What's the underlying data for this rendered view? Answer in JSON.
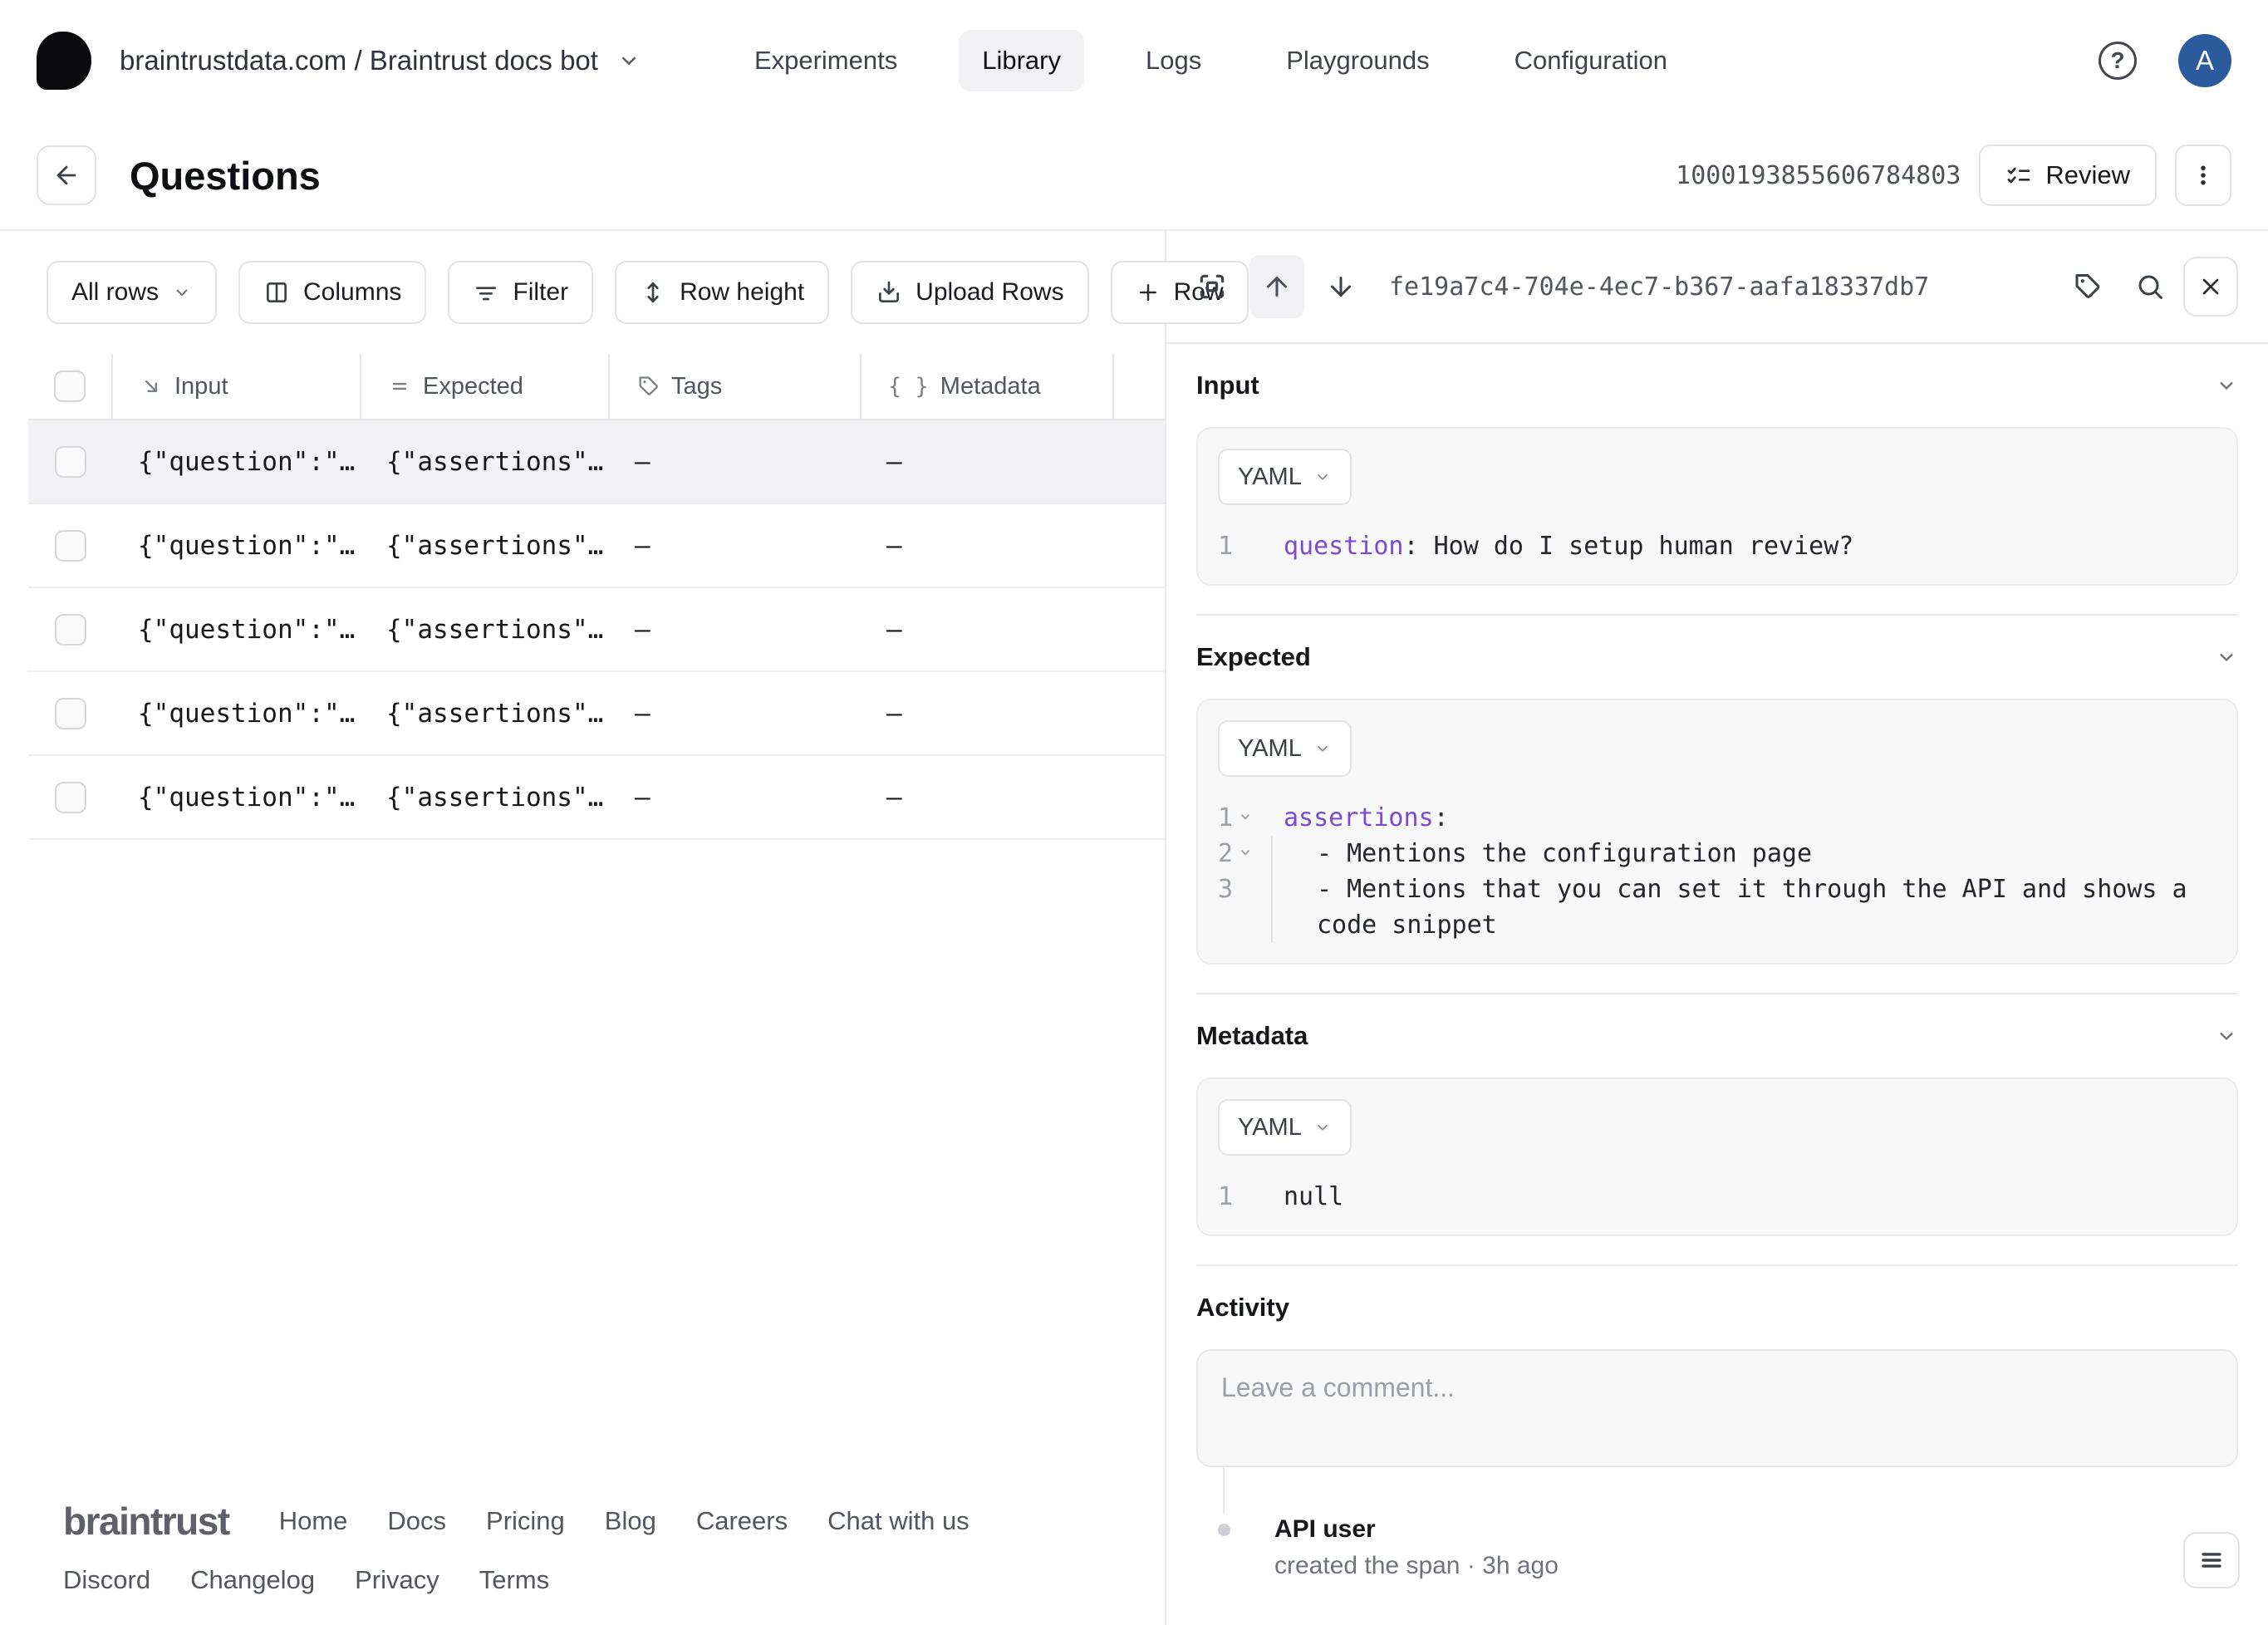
{
  "colors": {
    "accent_purple": "#7a4bd2",
    "avatar_blue": "#2b5b9d",
    "active_tab_bg": "#f2f2f4",
    "selected_row_bg": "#f2f2f4"
  },
  "topnav": {
    "breadcrumb": "braintrustdata.com / Braintrust docs bot",
    "tabs": [
      {
        "label": "Experiments"
      },
      {
        "label": "Library"
      },
      {
        "label": "Logs"
      },
      {
        "label": "Playgrounds"
      },
      {
        "label": "Configuration"
      }
    ],
    "active_tab": "Library",
    "avatar_initial": "A"
  },
  "page_header": {
    "title": "Questions",
    "dataset_id": "1000193855606784803",
    "review_label": "Review"
  },
  "toolbar": {
    "rows_filter_label": "All rows",
    "columns_label": "Columns",
    "filter_label": "Filter",
    "row_height_label": "Row height",
    "upload_rows_label": "Upload Rows",
    "add_row_label": "Row"
  },
  "table": {
    "columns": [
      {
        "label": "Input"
      },
      {
        "label": "Expected"
      },
      {
        "label": "Tags"
      },
      {
        "label": "Metadata"
      }
    ],
    "rows": [
      {
        "input": "{\"question\":\"…",
        "expected": "{\"assertions\"…",
        "tags": "–",
        "metadata": "–"
      },
      {
        "input": "{\"question\":\"…",
        "expected": "{\"assertions\"…",
        "tags": "–",
        "metadata": "–"
      },
      {
        "input": "{\"question\":\"…",
        "expected": "{\"assertions\"…",
        "tags": "–",
        "metadata": "–"
      },
      {
        "input": "{\"question\":\"…",
        "expected": "{\"assertions\"…",
        "tags": "–",
        "metadata": "–"
      },
      {
        "input": "{\"question\":\"…",
        "expected": "{\"assertions\"…",
        "tags": "–",
        "metadata": "–"
      }
    ]
  },
  "detail": {
    "span_id": "fe19a7c4-704e-4ec7-b367-aafa18337db7",
    "input": {
      "title": "Input",
      "format": "YAML",
      "line_no": "1",
      "key": "question",
      "rest": ": How do I setup human review?"
    },
    "expected": {
      "title": "Expected",
      "format": "YAML",
      "lines": [
        {
          "no": "1",
          "key": "assertions",
          "rest": ":"
        },
        {
          "no": "2",
          "text": "- Mentions the configuration page"
        },
        {
          "no": "3",
          "text": "- Mentions that you can set it through the API and shows a code snippet"
        }
      ]
    },
    "metadata": {
      "title": "Metadata",
      "format": "YAML",
      "line_no": "1",
      "value": "null"
    },
    "activity": {
      "title": "Activity",
      "comment_placeholder": "Leave a comment...",
      "event_user": "API user",
      "event_text": "created the span · 3h ago"
    }
  },
  "footer": {
    "logo": "braintrust",
    "links_row1": [
      {
        "label": "Home"
      },
      {
        "label": "Docs"
      },
      {
        "label": "Pricing"
      },
      {
        "label": "Blog"
      },
      {
        "label": "Careers"
      },
      {
        "label": "Chat with us"
      }
    ],
    "links_row2": [
      {
        "label": "Discord"
      },
      {
        "label": "Changelog"
      },
      {
        "label": "Privacy"
      },
      {
        "label": "Terms"
      }
    ]
  }
}
